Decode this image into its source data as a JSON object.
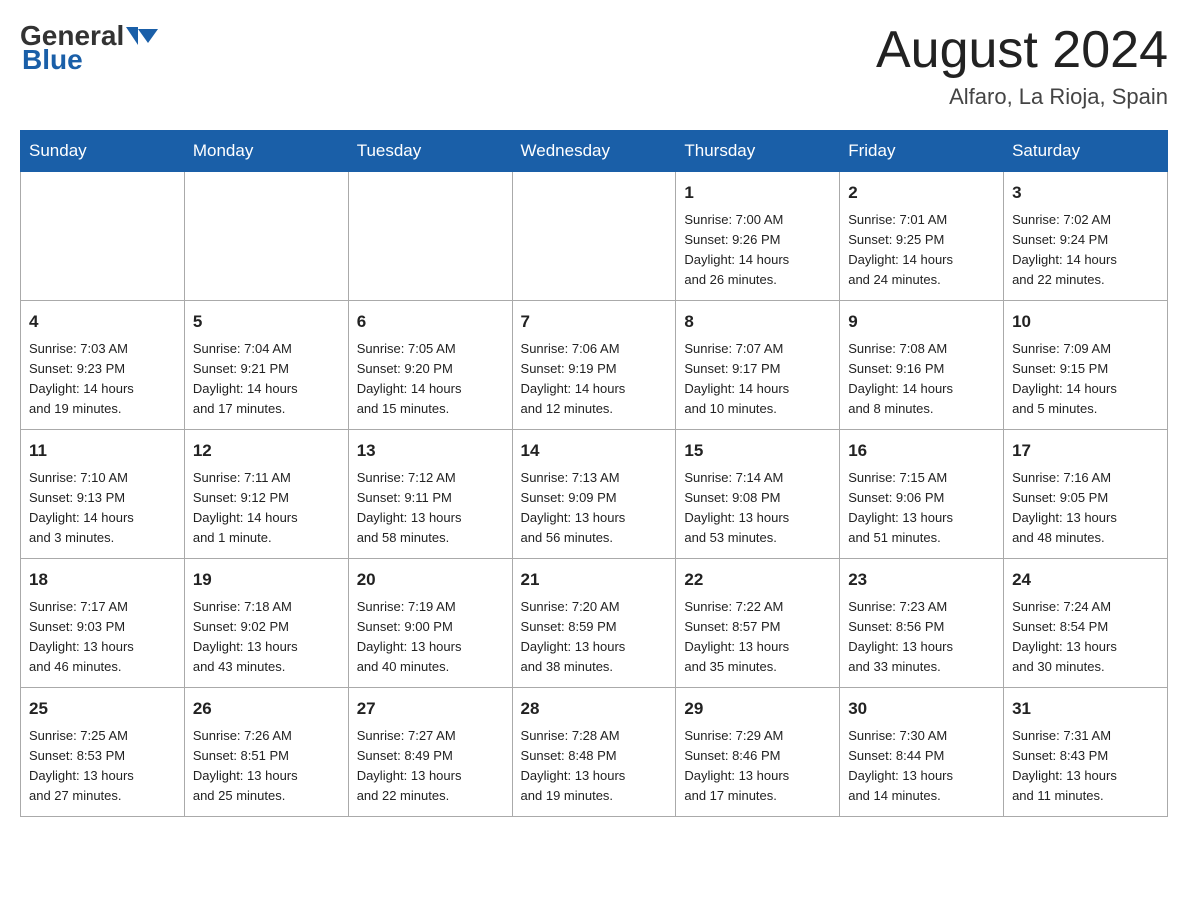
{
  "header": {
    "logo_general": "General",
    "logo_blue": "Blue",
    "month_title": "August 2024",
    "location": "Alfaro, La Rioja, Spain"
  },
  "weekdays": [
    "Sunday",
    "Monday",
    "Tuesday",
    "Wednesday",
    "Thursday",
    "Friday",
    "Saturday"
  ],
  "weeks": [
    [
      {
        "day": "",
        "info": ""
      },
      {
        "day": "",
        "info": ""
      },
      {
        "day": "",
        "info": ""
      },
      {
        "day": "",
        "info": ""
      },
      {
        "day": "1",
        "info": "Sunrise: 7:00 AM\nSunset: 9:26 PM\nDaylight: 14 hours\nand 26 minutes."
      },
      {
        "day": "2",
        "info": "Sunrise: 7:01 AM\nSunset: 9:25 PM\nDaylight: 14 hours\nand 24 minutes."
      },
      {
        "day": "3",
        "info": "Sunrise: 7:02 AM\nSunset: 9:24 PM\nDaylight: 14 hours\nand 22 minutes."
      }
    ],
    [
      {
        "day": "4",
        "info": "Sunrise: 7:03 AM\nSunset: 9:23 PM\nDaylight: 14 hours\nand 19 minutes."
      },
      {
        "day": "5",
        "info": "Sunrise: 7:04 AM\nSunset: 9:21 PM\nDaylight: 14 hours\nand 17 minutes."
      },
      {
        "day": "6",
        "info": "Sunrise: 7:05 AM\nSunset: 9:20 PM\nDaylight: 14 hours\nand 15 minutes."
      },
      {
        "day": "7",
        "info": "Sunrise: 7:06 AM\nSunset: 9:19 PM\nDaylight: 14 hours\nand 12 minutes."
      },
      {
        "day": "8",
        "info": "Sunrise: 7:07 AM\nSunset: 9:17 PM\nDaylight: 14 hours\nand 10 minutes."
      },
      {
        "day": "9",
        "info": "Sunrise: 7:08 AM\nSunset: 9:16 PM\nDaylight: 14 hours\nand 8 minutes."
      },
      {
        "day": "10",
        "info": "Sunrise: 7:09 AM\nSunset: 9:15 PM\nDaylight: 14 hours\nand 5 minutes."
      }
    ],
    [
      {
        "day": "11",
        "info": "Sunrise: 7:10 AM\nSunset: 9:13 PM\nDaylight: 14 hours\nand 3 minutes."
      },
      {
        "day": "12",
        "info": "Sunrise: 7:11 AM\nSunset: 9:12 PM\nDaylight: 14 hours\nand 1 minute."
      },
      {
        "day": "13",
        "info": "Sunrise: 7:12 AM\nSunset: 9:11 PM\nDaylight: 13 hours\nand 58 minutes."
      },
      {
        "day": "14",
        "info": "Sunrise: 7:13 AM\nSunset: 9:09 PM\nDaylight: 13 hours\nand 56 minutes."
      },
      {
        "day": "15",
        "info": "Sunrise: 7:14 AM\nSunset: 9:08 PM\nDaylight: 13 hours\nand 53 minutes."
      },
      {
        "day": "16",
        "info": "Sunrise: 7:15 AM\nSunset: 9:06 PM\nDaylight: 13 hours\nand 51 minutes."
      },
      {
        "day": "17",
        "info": "Sunrise: 7:16 AM\nSunset: 9:05 PM\nDaylight: 13 hours\nand 48 minutes."
      }
    ],
    [
      {
        "day": "18",
        "info": "Sunrise: 7:17 AM\nSunset: 9:03 PM\nDaylight: 13 hours\nand 46 minutes."
      },
      {
        "day": "19",
        "info": "Sunrise: 7:18 AM\nSunset: 9:02 PM\nDaylight: 13 hours\nand 43 minutes."
      },
      {
        "day": "20",
        "info": "Sunrise: 7:19 AM\nSunset: 9:00 PM\nDaylight: 13 hours\nand 40 minutes."
      },
      {
        "day": "21",
        "info": "Sunrise: 7:20 AM\nSunset: 8:59 PM\nDaylight: 13 hours\nand 38 minutes."
      },
      {
        "day": "22",
        "info": "Sunrise: 7:22 AM\nSunset: 8:57 PM\nDaylight: 13 hours\nand 35 minutes."
      },
      {
        "day": "23",
        "info": "Sunrise: 7:23 AM\nSunset: 8:56 PM\nDaylight: 13 hours\nand 33 minutes."
      },
      {
        "day": "24",
        "info": "Sunrise: 7:24 AM\nSunset: 8:54 PM\nDaylight: 13 hours\nand 30 minutes."
      }
    ],
    [
      {
        "day": "25",
        "info": "Sunrise: 7:25 AM\nSunset: 8:53 PM\nDaylight: 13 hours\nand 27 minutes."
      },
      {
        "day": "26",
        "info": "Sunrise: 7:26 AM\nSunset: 8:51 PM\nDaylight: 13 hours\nand 25 minutes."
      },
      {
        "day": "27",
        "info": "Sunrise: 7:27 AM\nSunset: 8:49 PM\nDaylight: 13 hours\nand 22 minutes."
      },
      {
        "day": "28",
        "info": "Sunrise: 7:28 AM\nSunset: 8:48 PM\nDaylight: 13 hours\nand 19 minutes."
      },
      {
        "day": "29",
        "info": "Sunrise: 7:29 AM\nSunset: 8:46 PM\nDaylight: 13 hours\nand 17 minutes."
      },
      {
        "day": "30",
        "info": "Sunrise: 7:30 AM\nSunset: 8:44 PM\nDaylight: 13 hours\nand 14 minutes."
      },
      {
        "day": "31",
        "info": "Sunrise: 7:31 AM\nSunset: 8:43 PM\nDaylight: 13 hours\nand 11 minutes."
      }
    ]
  ]
}
